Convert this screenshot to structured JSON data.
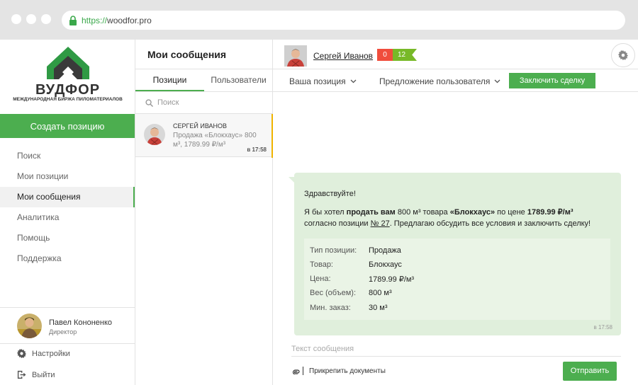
{
  "browser": {
    "url_scheme": "https://",
    "url_host": "woodfor.pro"
  },
  "brand": {
    "name": "ВУДФОР",
    "tagline": "МЕЖДУНАРОДНАЯ БИРЖА ПИЛОМАТЕРИАЛОВ",
    "accent": "#4cae4f"
  },
  "sidebar": {
    "create_label": "Создать позицию",
    "items": [
      {
        "label": "Поиск"
      },
      {
        "label": "Мои позиции"
      },
      {
        "label": "Мои сообщения"
      },
      {
        "label": "Аналитика"
      },
      {
        "label": "Помощь"
      },
      {
        "label": "Поддержка"
      }
    ],
    "active_index": 2,
    "user": {
      "name": "Павел Кононенко",
      "role": "Директор"
    },
    "settings_label": "Настройки",
    "logout_label": "Выйти"
  },
  "messages_panel": {
    "title": "Мои сообщения",
    "tabs": [
      {
        "label": "Позиции"
      },
      {
        "label": "Пользователи"
      }
    ],
    "search_placeholder": "Поиск",
    "threads": [
      {
        "name": "СЕРГЕЙ ИВАНОВ",
        "preview": "Продажа «Блокхаус» 800 м³, 1789.99 ₽/м³",
        "time": "в 17:58"
      }
    ]
  },
  "conversation": {
    "contact_name": "Сергей Иванов",
    "rating_negative": "0",
    "rating_positive": "12",
    "toolbar": {
      "your_position": "Ваша позиция",
      "user_offer": "Предложение пользователя",
      "deal_label": "Заключить сделку"
    },
    "message": {
      "greeting": "Здравствуйте!",
      "p1": "Я бы хотел ",
      "p2": "продать вам",
      "p3": " 800 м³ товара ",
      "p4": "«Блокхаус»",
      "p5": " по цене ",
      "p6": "1789.99 ₽/м³",
      "p7": "согласно позиции ",
      "p8": "№ 27",
      "p9": ". Предлагаю обсудить все условия и заключить сделку!",
      "details": [
        {
          "label": "Тип позиции:",
          "value": "Продажа"
        },
        {
          "label": "Товар:",
          "value": "Блокхаус"
        },
        {
          "label": "Цена:",
          "value": "1789.99 ₽/м³"
        },
        {
          "label": "Вес (объем):",
          "value": "800 м³"
        },
        {
          "label": "Мин. заказ:",
          "value": "30 м³"
        }
      ],
      "time": "в 17:58"
    },
    "compose_placeholder": "Текст сообщения",
    "attach_label": "Прикрепить документы",
    "send_label": "Отправить"
  }
}
